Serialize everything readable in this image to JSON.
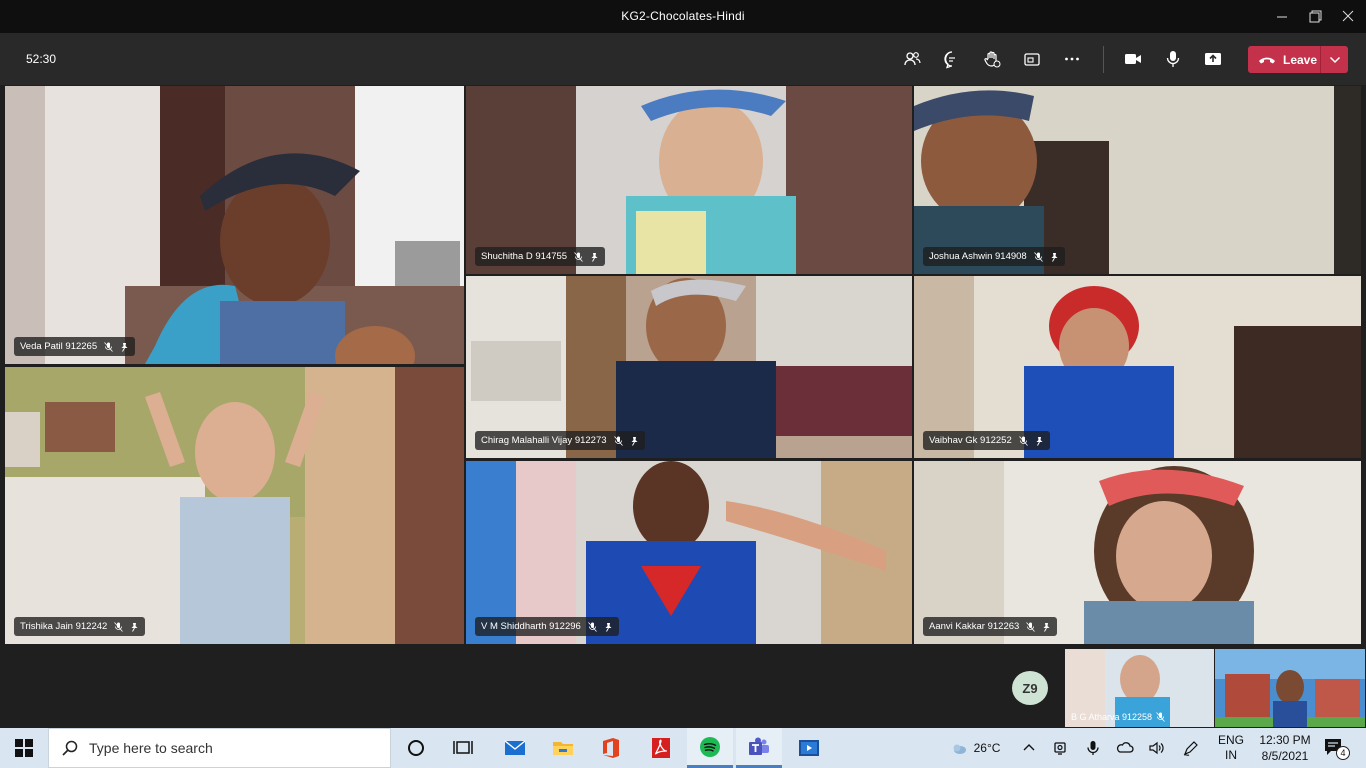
{
  "window": {
    "title": "KG2-Chocolates-Hindi"
  },
  "toolbar": {
    "timer": "52:30",
    "leave_label": "Leave",
    "icons": [
      "participants-icon",
      "chat-icon",
      "raise-hand-icon",
      "breakout-rooms-icon",
      "more-actions-icon",
      "camera-icon",
      "microphone-icon",
      "share-tray-icon",
      "phone-hangup-icon",
      "chevron-down-icon"
    ]
  },
  "participants": [
    {
      "name": "Veda Patil 912265"
    },
    {
      "name": "Shuchitha D 914755"
    },
    {
      "name": "Joshua Ashwin 914908"
    },
    {
      "name": "Chirag Malahalli Vijay 912273"
    },
    {
      "name": "Vaibhav Gk 912252"
    },
    {
      "name": "Trishika Jain 912242"
    },
    {
      "name": "V M Shiddharth 912296"
    },
    {
      "name": "Aanvi Kakkar 912263"
    }
  ],
  "overflow": {
    "initials": "Z9"
  },
  "thumbnails": [
    {
      "name": "B G Atharva 912258"
    }
  ],
  "taskbar": {
    "search_placeholder": "Type here to search",
    "apps": [
      "task-view-icon",
      "mail-icon",
      "file-explorer-icon",
      "office-icon",
      "acrobat-icon",
      "spotify-icon",
      "teams-icon",
      "media-player-icon"
    ],
    "weather": "26°C",
    "language_line1": "ENG",
    "language_line2": "IN",
    "time": "12:30 PM",
    "date": "8/5/2021",
    "notification_count": "4"
  }
}
